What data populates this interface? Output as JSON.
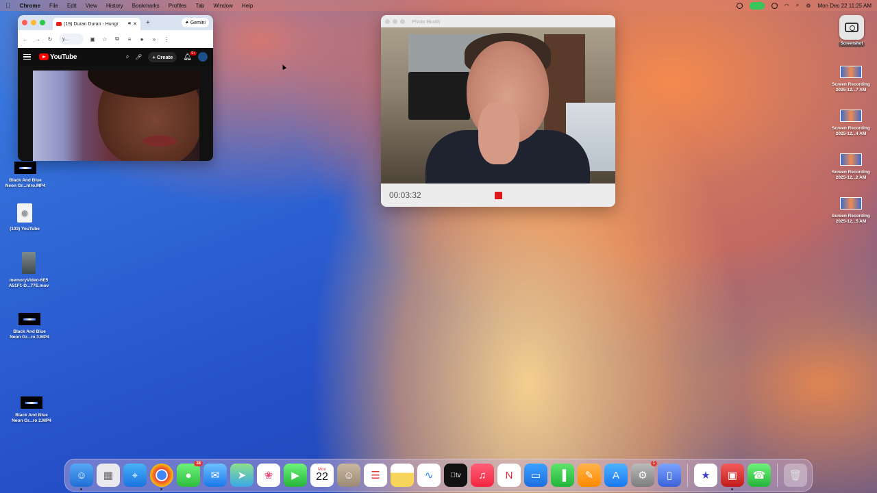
{
  "menubar": {
    "app": "Chrome",
    "items": [
      "File",
      "Edit",
      "View",
      "History",
      "Bookmarks",
      "Profiles",
      "Tab",
      "Window",
      "Help"
    ],
    "datetime": "Mon Dec 22  11:25 AM"
  },
  "chrome": {
    "tab_title": "(19) Duran Duran - Hungr",
    "new_tab": "+",
    "gemini_label": "Gemini",
    "omnibox_text": "y...",
    "more": "»",
    "youtube": {
      "logo_text": "YouTube",
      "create_label": "Create",
      "notifications": "9+"
    }
  },
  "photobooth": {
    "title": "Photo Booth",
    "timer": "00:03:32"
  },
  "desktop_left": [
    {
      "label_line1": "Black And Blue",
      "label_line2": "Neon Gr...ntro.MP4"
    },
    {
      "label_line1": "(103) YouTube",
      "label_line2": ""
    },
    {
      "label_line1": "memoryVideo-6E5",
      "label_line2": "A51F1-D...77E.mov"
    },
    {
      "label_line1": "Black And Blue",
      "label_line2": "Neon Gr...ro 3.MP4"
    },
    {
      "label_line1": "Black And Blue",
      "label_line2": "Neon Gr...ro 2.MP4"
    }
  ],
  "desktop_right": {
    "screenshot_label": "Screenshot",
    "recordings": [
      {
        "line1": "Screen Recording",
        "line2": "2025-12...7 AM"
      },
      {
        "line1": "Screen Recording",
        "line2": "2025-12...4 AM"
      },
      {
        "line1": "Screen Recording",
        "line2": "2025-12...2 AM"
      },
      {
        "line1": "Screen Recording",
        "line2": "2025-12...5 AM"
      }
    ]
  },
  "dock": {
    "messages_badge": "38",
    "calendar_month": "Mon",
    "calendar_day": "22",
    "settings_badge": "1",
    "tv_label": "tv"
  }
}
